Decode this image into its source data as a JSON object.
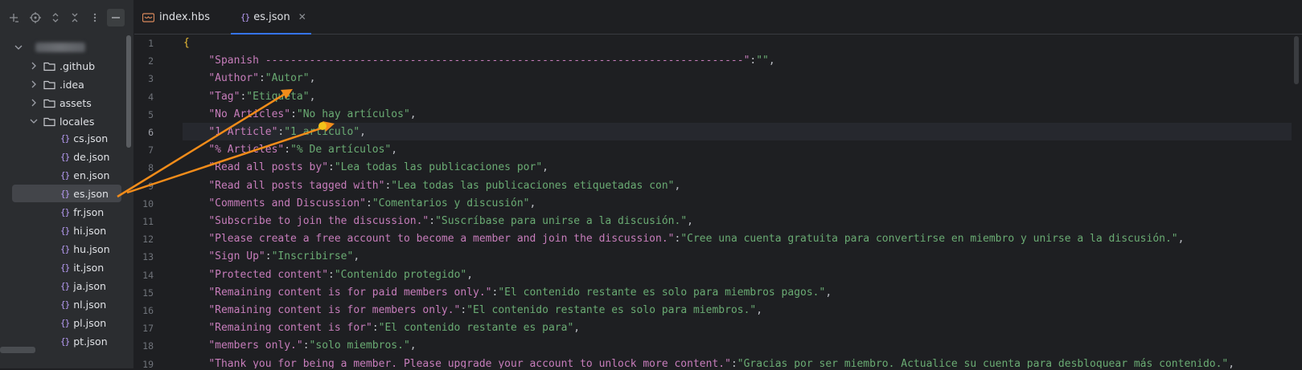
{
  "sidebar": {
    "tools": [
      {
        "name": "new-icon",
        "glyph": "+"
      },
      {
        "name": "locate-icon",
        "glyph": "◎"
      },
      {
        "name": "expand-all-icon",
        "glyph": "⌃"
      },
      {
        "name": "collapse-all-icon",
        "glyph": "✕"
      },
      {
        "name": "more-icon",
        "glyph": "⋮"
      },
      {
        "name": "hide-icon",
        "glyph": "—"
      }
    ],
    "folders": [
      ".github",
      ".idea",
      "assets",
      "locales"
    ],
    "files": [
      "cs.json",
      "de.json",
      "en.json",
      "es.json",
      "fr.json",
      "hi.json",
      "hu.json",
      "it.json",
      "ja.json",
      "nl.json",
      "pl.json",
      "pt.json"
    ],
    "selected_file": "es.json"
  },
  "tabs": [
    {
      "label": "index.hbs",
      "icon": "handlebars-icon"
    },
    {
      "label": "es.json",
      "icon": "json-icon"
    }
  ],
  "editor": {
    "current_line": 6,
    "line_numbers": [
      "1",
      "2",
      "3",
      "4",
      "5",
      "6",
      "7",
      "8",
      "9",
      "10",
      "11",
      "12",
      "13",
      "14",
      "15",
      "16",
      "17",
      "18",
      "19"
    ],
    "lines": [
      {
        "key": "{",
        "value": "",
        "brace": true
      },
      {
        "key": "\"Spanish ----------------------------------------------------------------------------\"",
        "value": "\"\""
      },
      {
        "key": "\"Author\"",
        "value": "\"Autor\""
      },
      {
        "key": "\"Tag\"",
        "value": "\"Etiqueta\""
      },
      {
        "key": "\"No Articles\"",
        "value": "\"No hay artículos\""
      },
      {
        "key": "\"1 Article\"",
        "value": "\"1 artículo\""
      },
      {
        "key": "\"% Articles\"",
        "value": "\"% De artículos\""
      },
      {
        "key": "\"Read all posts by\"",
        "value": "\"Lea todas las publicaciones por\""
      },
      {
        "key": "\"Read all posts tagged with\"",
        "value": "\"Lea todas las publicaciones etiquetadas con\""
      },
      {
        "key": "\"Comments and Discussion\"",
        "value": "\"Comentarios y discusión\""
      },
      {
        "key": "\"Subscribe to join the discussion.\"",
        "value": "\"Suscríbase para unirse a la discusión.\""
      },
      {
        "key": "\"Please create a free account to become a member and join the discussion.\"",
        "value": "\"Cree una cuenta gratuita para convertirse en miembro y unirse a la discusión.\""
      },
      {
        "key": "\"Sign Up\"",
        "value": "\"Inscribirse\""
      },
      {
        "key": "\"Protected content\"",
        "value": "\"Contenido protegido\""
      },
      {
        "key": "\"Remaining content is for paid members only.\"",
        "value": "\"El contenido restante es solo para miembros pagos.\""
      },
      {
        "key": "\"Remaining content is for members only.\"",
        "value": "\"El contenido restante es solo para miembros.\""
      },
      {
        "key": "\"Remaining content is for\"",
        "value": "\"El contenido restante es para\""
      },
      {
        "key": "\"members only.\"",
        "value": "\"solo miembros.\""
      },
      {
        "key": "\"Thank you for being a member. Please upgrade your account to unlock more content.\"",
        "value": "\"Gracias por ser miembro. Actualice su cuenta para desbloquear más contenido.\""
      }
    ]
  },
  "annotation": {
    "color": "#f28c1a"
  }
}
